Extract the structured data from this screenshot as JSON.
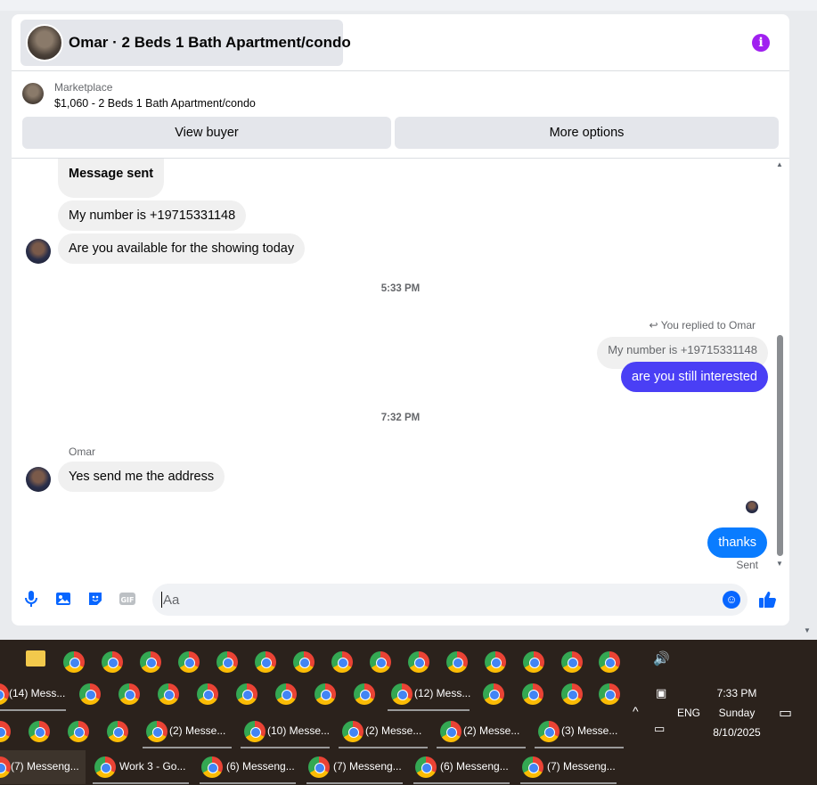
{
  "header": {
    "title": "Omar · 2 Beds 1 Bath Apartment/condo"
  },
  "marketplace": {
    "label": "Marketplace",
    "listing": "$1,060 - 2 Beds 1 Bath Apartment/condo",
    "view_buyer": "View buyer",
    "more_options": "More options"
  },
  "messages": {
    "m1": "Message sent",
    "m2": "My number is +19715331148",
    "m3": "Are you available for the showing today",
    "ts1": "5:33 PM",
    "reply_note": "You replied to Omar",
    "quoted": "My number is +19715331148",
    "m4": "are you still interested",
    "ts2": "7:32 PM",
    "sender": "Omar",
    "m5": "Yes send me the address",
    "m6": "thanks",
    "status": "Sent"
  },
  "composer": {
    "placeholder": "Aa"
  },
  "taskbar": {
    "row2": {
      "b1": "(14) Mess...",
      "b2": "(12) Mess..."
    },
    "row3": {
      "b1": "(2) Messe...",
      "b2": "(10) Messe...",
      "b3": "(2) Messe...",
      "b4": "(2) Messe...",
      "b5": "(3) Messe..."
    },
    "row4": {
      "b1": "(7) Messeng...",
      "b2": "Work 3 - Go...",
      "b3": "(6) Messeng...",
      "b4": "(7) Messeng...",
      "b5": "(6) Messeng...",
      "b6": "(7) Messeng..."
    },
    "tray": {
      "lang": "ENG",
      "time": "7:33 PM",
      "day": "Sunday",
      "date": "8/10/2025"
    }
  },
  "colors": {
    "accent": "#0866ff",
    "outgoing": "#4a3ff5",
    "info": "#a020f0"
  },
  "icons": [
    "info-icon",
    "mic-icon",
    "photo-icon",
    "sticker-icon",
    "gif-icon",
    "emoji-icon",
    "like-icon",
    "reply-icon",
    "volume-icon",
    "chevron-up-icon",
    "notification-icon"
  ]
}
